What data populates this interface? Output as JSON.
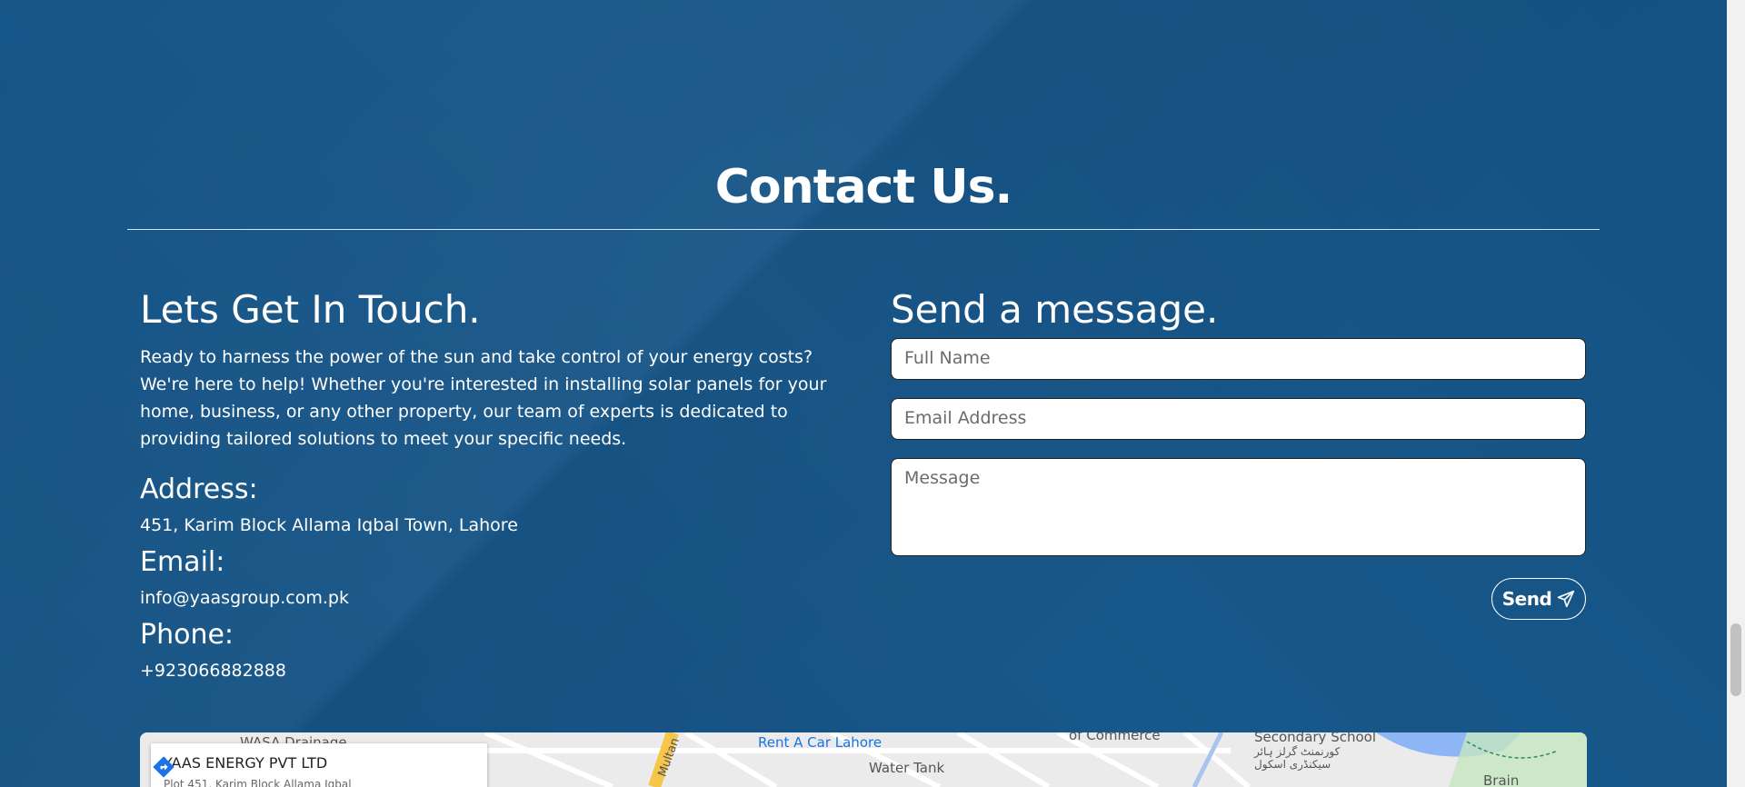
{
  "title": "Contact Us.",
  "left": {
    "heading": "Lets Get In Touch.",
    "intro": "Ready to harness the power of the sun and take control of your energy costs? We're here to help! Whether you're interested in installing solar panels for your home, business, or any other property, our team of experts is dedicated to providing tailored solutions to meet your specific needs.",
    "address_label": "Address:",
    "address": "451, Karim Block Allama Iqbal Town, Lahore",
    "email_label": "Email:",
    "email": "info@yaasgroup.com.pk",
    "phone_label": "Phone:",
    "phone": "+923066882888"
  },
  "right": {
    "heading": "Send a message.",
    "name_placeholder": "Full Name",
    "email_placeholder": "Email Address",
    "message_placeholder": "Message",
    "send_label": "Send"
  },
  "map": {
    "business_name": "YAAS ENERGY PVT LTD",
    "business_address": "Plot 451, Karim Block Allama Iqbal",
    "labels": [
      "WASA Drainage",
      "Rent A Car Lahore",
      "Water Tank",
      "of Commerce",
      "Secondary School",
      "کورنمنٹ گرلز ہائر",
      "سیکنڈری اسکول",
      "Brain",
      "Multan"
    ]
  },
  "colors": {
    "background": "#145487",
    "accent": "#ffffff"
  }
}
